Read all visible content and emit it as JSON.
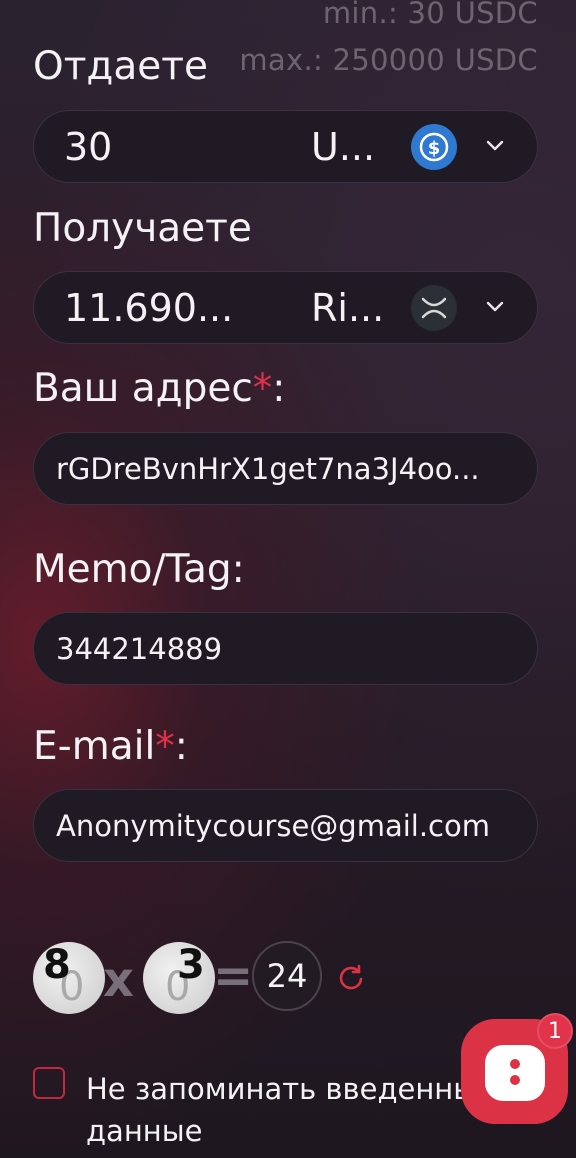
{
  "limits": {
    "min": "min.: 30 USDC",
    "max": "max.: 250000 USDC"
  },
  "send": {
    "label": "Отдаете",
    "amount": "30",
    "currency": "U...",
    "icon": "usdc-coin-icon",
    "icon_color": "#2775ca"
  },
  "receive": {
    "label": "Получаете",
    "amount": "11.690...",
    "currency": "Ri...",
    "icon": "xrp-coin-icon",
    "icon_color": "#23292f"
  },
  "address": {
    "label": "Ваш адрес",
    "required_mark": "*",
    "suffix": ":",
    "value": "rGDreBvnHrX1get7na3J4oo..."
  },
  "memo": {
    "label": "Memo/Tag:",
    "value": "344214889"
  },
  "email": {
    "label": "E-mail",
    "required_mark": "*",
    "suffix": ":",
    "value": "Anonymitycourse@gmail.com"
  },
  "captcha": {
    "digit1": "8",
    "operator": "x",
    "digit2": "3",
    "equals": "=",
    "answer": "24"
  },
  "remember": {
    "label": "Не запоминать введенные данные",
    "checked": false
  },
  "chat": {
    "badge": "1"
  },
  "colors": {
    "accent": "#dc3246",
    "field_bg": "#201a24"
  }
}
